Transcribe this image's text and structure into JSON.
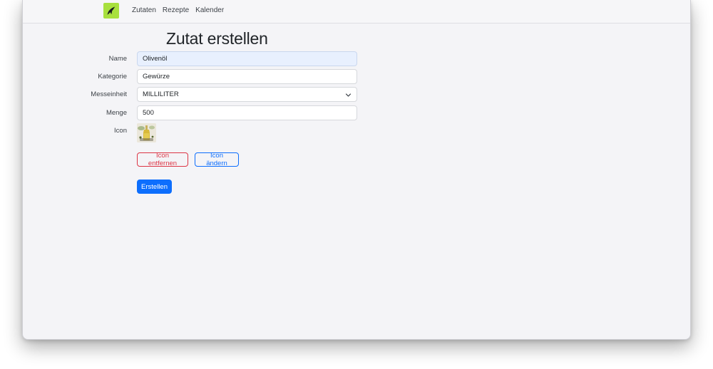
{
  "nav": {
    "logo_icon": "feather-icon",
    "links": [
      "Zutaten",
      "Rezepte",
      "Kalender"
    ]
  },
  "page": {
    "title": "Zutat erstellen"
  },
  "form": {
    "name": {
      "label": "Name",
      "value": "Olivenöl"
    },
    "kategorie": {
      "label": "Kategorie",
      "value": "Gewürze"
    },
    "messeinheit": {
      "label": "Messeinheit",
      "value": "MILLILITER"
    },
    "menge": {
      "label": "Menge",
      "value": "500"
    },
    "icon": {
      "label": "Icon",
      "image": "olive-oil-bottle-image"
    }
  },
  "buttons": {
    "remove_icon": "Icon entfernen",
    "change_icon": "Icon ändern",
    "submit": "Erstellen"
  },
  "colors": {
    "logo_bg": "#a8e03e",
    "primary": "#0d6efd",
    "danger": "#dc3545",
    "active_field_bg": "#e8f0fe"
  }
}
